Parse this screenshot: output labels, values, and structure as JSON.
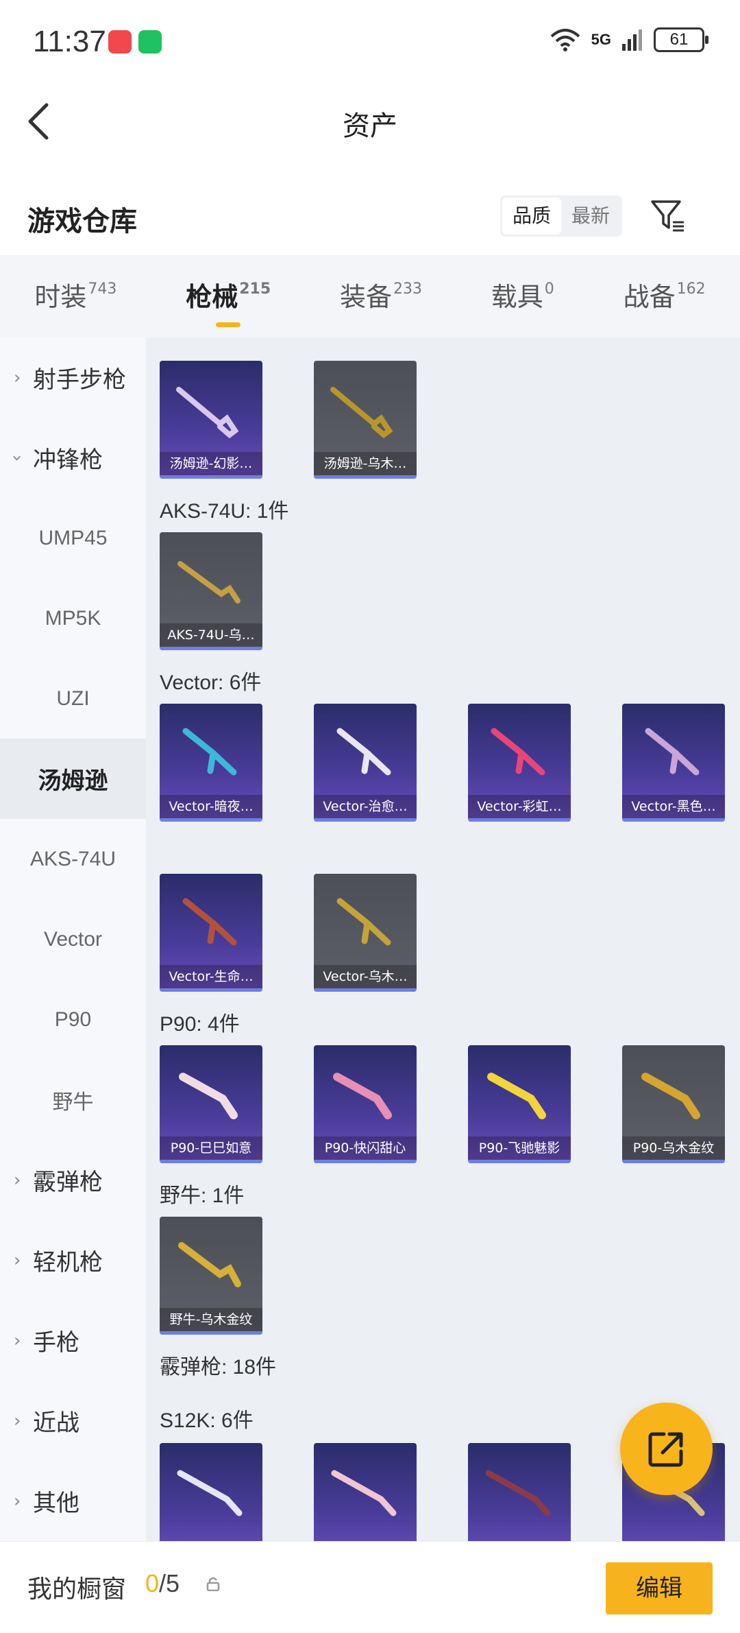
{
  "status_bar": {
    "time": "11:37",
    "network": "5G",
    "battery": "61"
  },
  "header": {
    "title": "资产"
  },
  "store": {
    "title": "游戏仓库",
    "sort_options": [
      "品质",
      "最新"
    ],
    "sort_selected": "品质"
  },
  "tabs": [
    {
      "label": "时装",
      "count": "743"
    },
    {
      "label": "枪械",
      "count": "215",
      "active": true
    },
    {
      "label": "装备",
      "count": "233"
    },
    {
      "label": "载具",
      "count": "0"
    },
    {
      "label": "战备",
      "count": "162"
    }
  ],
  "sidebar": {
    "items": [
      {
        "label": "射手步枪"
      },
      {
        "label": "冲锋枪"
      },
      {
        "label": "UMP45"
      },
      {
        "label": "MP5K"
      },
      {
        "label": "UZI"
      },
      {
        "label": "汤姆逊"
      },
      {
        "label": "AKS-74U"
      },
      {
        "label": "Vector"
      },
      {
        "label": "P90"
      },
      {
        "label": "野牛"
      },
      {
        "label": "霰弹枪"
      },
      {
        "label": "轻机枪"
      },
      {
        "label": "手枪"
      },
      {
        "label": "近战"
      },
      {
        "label": "其他"
      }
    ]
  },
  "groups": [
    {
      "label": "",
      "items": [
        "汤姆逊-幻影…",
        "汤姆逊-乌木…"
      ]
    },
    {
      "label": "AKS-74U: 1件",
      "items": [
        "AKS-74U-乌…"
      ]
    },
    {
      "label": "Vector: 6件",
      "items": [
        "Vector-暗夜…",
        "Vector-治愈…",
        "Vector-彩虹…",
        "Vector-黑色…",
        "Vector-生命…",
        "Vector-乌木…"
      ]
    },
    {
      "label": "P90: 4件",
      "items": [
        "P90-巳巳如意",
        "P90-快闪甜心",
        "P90-飞驰魅影",
        "P90-乌木金纹"
      ]
    },
    {
      "label": "野牛: 1件",
      "items": [
        "野牛-乌木金纹"
      ]
    },
    {
      "label": "霰弹枪: 18件",
      "items": []
    },
    {
      "label": "S12K: 6件",
      "items": []
    }
  ],
  "bottom_bar": {
    "label": "我的橱窗",
    "current": "0",
    "total": "/5",
    "edit_label": "编辑"
  },
  "colors": {
    "accent": "#f7b31d",
    "card_purple": "#3c3588",
    "card_gray": "#55575f"
  }
}
